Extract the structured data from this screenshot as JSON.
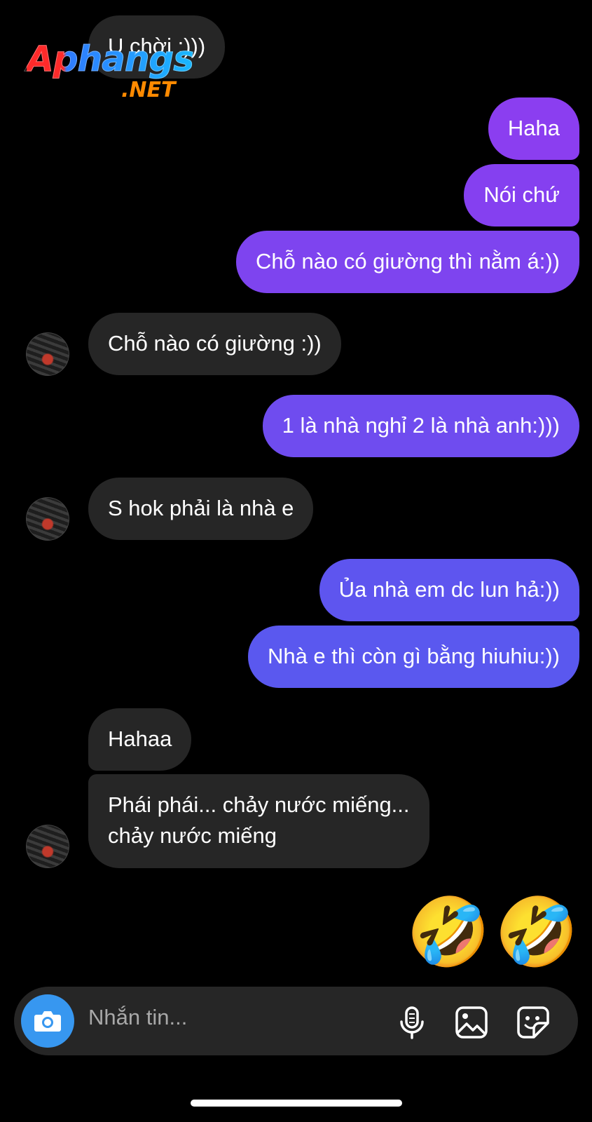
{
  "watermark": {
    "main": "Aphangs",
    "sub": ".NET"
  },
  "messages": [
    {
      "text": "U chời :)))",
      "side": "in"
    },
    {
      "text": "Haha",
      "side": "out",
      "color": "#8b3ef0"
    },
    {
      "text": "Nói chứ",
      "side": "out",
      "color": "#8540f0"
    },
    {
      "text": "Chỗ nào có giường thì nằm á:))",
      "side": "out",
      "color": "#7e44ef"
    },
    {
      "text": "Chỗ nào có giường :))",
      "side": "in"
    },
    {
      "text": "1 là nhà nghỉ 2 là nhà anh:)))",
      "side": "out",
      "color": "#6f4cef"
    },
    {
      "text": "S hok phải là nhà e",
      "side": "in"
    },
    {
      "text": "Ủa nhà em dc lun hả:))",
      "side": "out",
      "color": "#5e55ef"
    },
    {
      "text": "Nhà e thì còn gì bằng hiuhiu:))",
      "side": "out",
      "color": "#5a58ef"
    },
    {
      "text": "Hahaa",
      "side": "in"
    },
    {
      "line1": "Phái phái... chảy nước miếng...",
      "line2": "chảy nước miếng",
      "side": "in"
    }
  ],
  "reactions": [
    "🤣",
    "🤣"
  ],
  "composer": {
    "placeholder": "Nhắn tin...",
    "icons": [
      "camera-icon",
      "microphone-icon",
      "gallery-icon",
      "sticker-icon"
    ],
    "camera_color": "#3797f0"
  },
  "colors": {
    "background": "#000000",
    "incoming_bubble": "#262626"
  }
}
